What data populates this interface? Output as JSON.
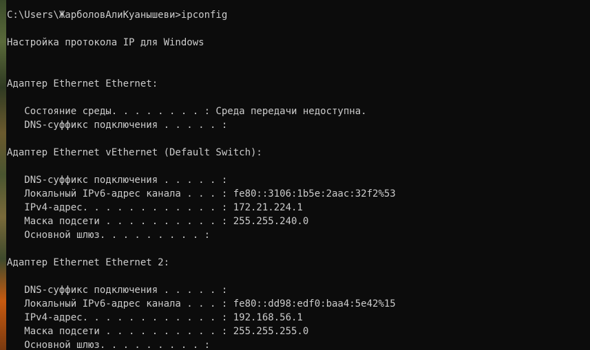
{
  "console": {
    "lines": [
      "C:\\Users\\ЖарболовАлиКуанышеви>ipconfig",
      "",
      "Настройка протокола IP для Windows",
      "",
      "",
      "Адаптер Ethernet Ethernet:",
      "",
      "   Состояние среды. . . . . . . . : Среда передачи недоступна.",
      "   DNS-суффикс подключения . . . . . :",
      "",
      "Адаптер Ethernet vEthernet (Default Switch):",
      "",
      "   DNS-суффикс подключения . . . . . :",
      "   Локальный IPv6-адрес канала . . . : fe80::3106:1b5e:2aac:32f2%53",
      "   IPv4-адрес. . . . . . . . . . . . : 172.21.224.1",
      "   Маска подсети . . . . . . . . . . : 255.255.240.0",
      "   Основной шлюз. . . . . . . . . :",
      "",
      "Адаптер Ethernet Ethernet 2:",
      "",
      "   DNS-суффикс подключения . . . . . :",
      "   Локальный IPv6-адрес канала . . . : fe80::dd98:edf0:baa4:5e42%15",
      "   IPv4-адрес. . . . . . . . . . . . : 192.168.56.1",
      "   Маска подсети . . . . . . . . . . : 255.255.255.0",
      "   Основной шлюз. . . . . . . . . :"
    ]
  },
  "colors": {
    "background": "#0c0c0c",
    "text": "#cccccc"
  }
}
